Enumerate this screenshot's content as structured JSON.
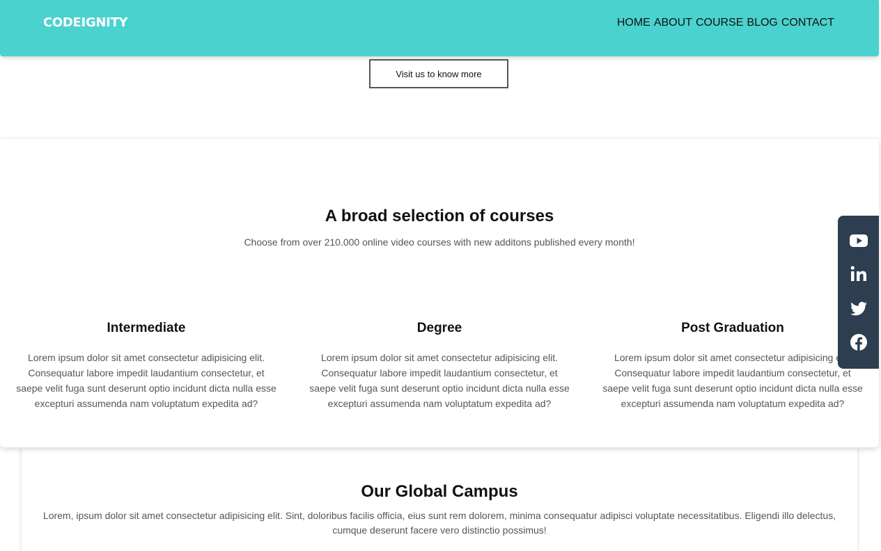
{
  "nav": {
    "brand": "CODEIGNITY",
    "links": [
      "HOME",
      "ABOUT",
      "COURSE",
      "BLOG",
      "CONTACT"
    ]
  },
  "hero": {
    "visit_button": "Visit us to know more"
  },
  "courses": {
    "title": "A broad selection of courses",
    "subtitle": "Choose from over 210.000 online video courses with new additons published every month!",
    "cards": [
      {
        "title": "Intermediate",
        "text": "Lorem ipsum dolor sit amet consectetur adipisicing elit. Consequatur labore impedit laudantium consectetur, et saepe velit fuga sunt deserunt optio incidunt dicta nulla esse excepturi assumenda nam voluptatum expedita ad?"
      },
      {
        "title": "Degree",
        "text": "Lorem ipsum dolor sit amet consectetur adipisicing elit. Consequatur labore impedit laudantium consectetur, et saepe velit fuga sunt deserunt optio incidunt dicta nulla esse excepturi assumenda nam voluptatum expedita ad?"
      },
      {
        "title": "Post Graduation",
        "text": "Lorem ipsum dolor sit amet consectetur adipisicing elit. Consequatur labore impedit laudantium consectetur, et saepe velit fuga sunt deserunt optio incidunt dicta nulla esse excepturi assumenda nam voluptatum expedita ad?"
      }
    ]
  },
  "campus": {
    "title": "Our Global Campus",
    "text": "Lorem, ipsum dolor sit amet consectetur adipisicing elit. Sint, doloribus facilis officia, eius sunt rem dolorem, minima consequatur adipisci voluptate necessitatibus. Eligendi illo delectus, cumque deserunt facere vero distinctio possimus!"
  },
  "social": {
    "icons": [
      "youtube-icon",
      "linkedin-icon",
      "twitter-icon",
      "facebook-icon"
    ]
  },
  "colors": {
    "navbar": "#4ad2cf",
    "social_bar": "#2c3e50"
  }
}
